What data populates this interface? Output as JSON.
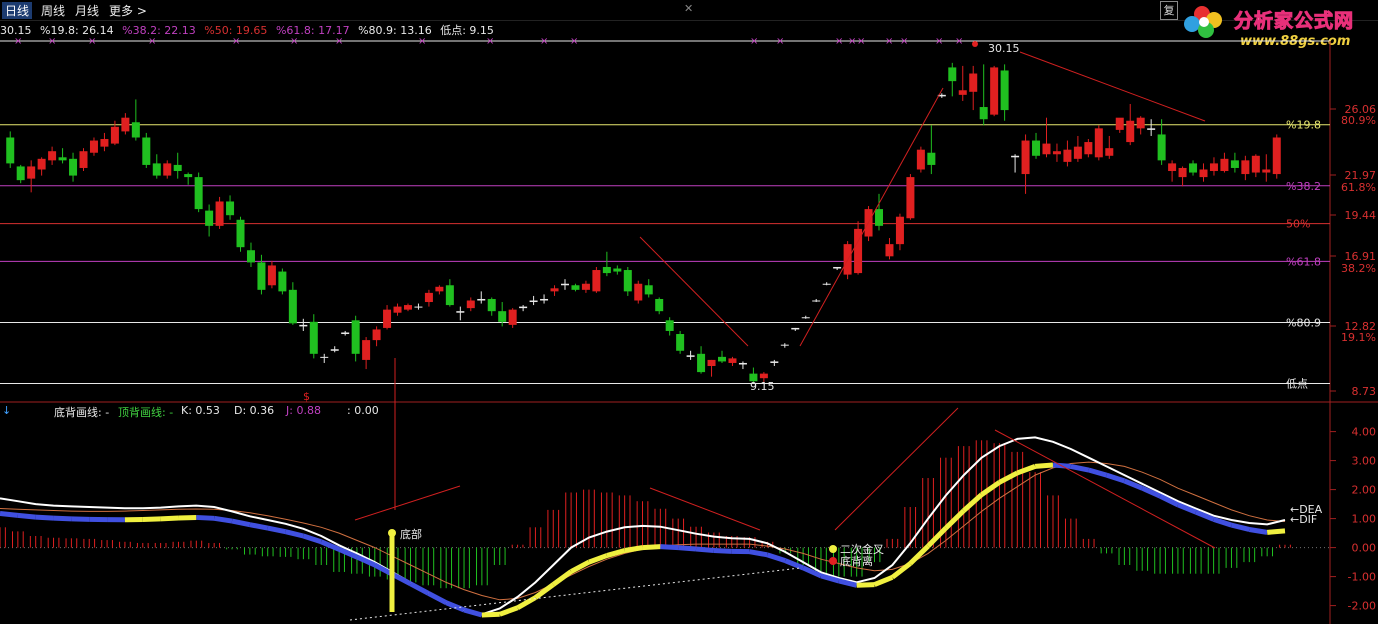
{
  "tabs": [
    "日线",
    "周线",
    "月线",
    "更多 >"
  ],
  "corner_button": "复",
  "logo": {
    "title": "分析家公式网",
    "url_text": "www.88gs.com"
  },
  "fib_header": [
    {
      "text": "30.15",
      "color": "#e8e8e8"
    },
    {
      "text": "%19.8: 26.14",
      "color": "#e8e8e8"
    },
    {
      "text": "%38.2: 22.13",
      "color": "#c040c0"
    },
    {
      "text": "%50: 19.65",
      "color": "#d83030"
    },
    {
      "text": "%61.8: 17.17",
      "color": "#c040c0"
    },
    {
      "text": "%80.9: 13.16",
      "color": "#e8e8e8"
    },
    {
      "text": "低点: 9.15",
      "color": "#e8e8e8"
    }
  ],
  "indicator_header": [
    {
      "text": "底背画线: -",
      "color": "#e8e8e8"
    },
    {
      "text": "顶背画线: -",
      "color": "#40d040"
    },
    {
      "text": "K: 0.53",
      "color": "#e8e8e8"
    },
    {
      "text": "D: 0.36",
      "color": "#e8e8e8"
    },
    {
      "text": "J: 0.88",
      "color": "#c040c0"
    },
    {
      "text": ": 0.00",
      "color": "#e8e8e8"
    }
  ],
  "chart_data": [
    {
      "type": "candlestick",
      "ylim": [
        8.2,
        31.7
      ],
      "y_axis_ticks": [
        {
          "price": "26.06",
          "pct": "80.9%"
        },
        {
          "price": "21.97",
          "pct": "61.8%"
        },
        {
          "price": "19.44",
          "pct": ""
        },
        {
          "price": "16.91",
          "pct": "38.2%"
        },
        {
          "price": "12.82",
          "pct": "19.1%"
        },
        {
          "price": "8.73",
          "pct": ""
        }
      ],
      "fib_levels": [
        {
          "label": "%19.8",
          "value": 26.14,
          "color": "#e8e870"
        },
        {
          "label": "%38.2",
          "value": 22.13,
          "color": "#c040c0"
        },
        {
          "label": "50%",
          "value": 19.65,
          "color": "#d83030"
        },
        {
          "label": "%61.8",
          "value": 17.17,
          "color": "#c040c0"
        },
        {
          "label": "%80.9",
          "value": 13.16,
          "color": "#e8e8e8"
        },
        {
          "label": "低点",
          "value": 9.15,
          "color": "#e8e8e8"
        }
      ],
      "annotations": [
        {
          "text": "30.15",
          "value": 30.15
        },
        {
          "text": "9.15",
          "value": 9.15
        }
      ],
      "candles": [
        [
          25.3,
          25.7,
          23.3,
          23.6
        ],
        [
          23.4,
          23.5,
          22.3,
          22.5
        ],
        [
          22.6,
          23.8,
          21.7,
          23.4
        ],
        [
          23.2,
          24.0,
          22.8,
          23.9
        ],
        [
          23.8,
          24.7,
          23.5,
          24.4
        ],
        [
          24.0,
          24.6,
          23.6,
          23.8
        ],
        [
          23.9,
          24.3,
          22.4,
          22.8
        ],
        [
          23.3,
          24.6,
          23.1,
          24.4
        ],
        [
          24.3,
          25.3,
          24.1,
          25.1
        ],
        [
          24.7,
          25.6,
          24.4,
          25.2
        ],
        [
          24.9,
          26.4,
          24.8,
          26.0
        ],
        [
          25.7,
          26.9,
          25.5,
          26.6
        ],
        [
          26.3,
          27.8,
          25.1,
          25.3
        ],
        [
          25.3,
          25.6,
          23.3,
          23.5
        ],
        [
          23.6,
          24.2,
          22.6,
          22.8
        ],
        [
          22.8,
          23.8,
          22.6,
          23.6
        ],
        [
          23.5,
          24.3,
          22.6,
          23.1
        ],
        [
          22.9,
          23.0,
          22.2,
          22.7
        ],
        [
          22.7,
          23.0,
          20.4,
          20.6
        ],
        [
          20.5,
          20.9,
          18.8,
          19.5
        ],
        [
          19.5,
          21.4,
          19.3,
          21.1
        ],
        [
          21.1,
          21.5,
          19.9,
          20.2
        ],
        [
          19.9,
          20.1,
          17.8,
          18.1
        ],
        [
          17.9,
          18.4,
          16.8,
          17.1
        ],
        [
          17.1,
          17.6,
          15.0,
          15.3
        ],
        [
          15.6,
          17.2,
          15.4,
          16.9
        ],
        [
          16.5,
          16.7,
          15.0,
          15.2
        ],
        [
          15.3,
          15.8,
          13.0,
          13.1
        ],
        [
          13.0,
          13.4,
          12.6,
          12.9
        ],
        [
          13.2,
          13.7,
          10.8,
          11.1
        ],
        [
          10.9,
          11.1,
          10.5,
          10.9
        ],
        [
          11.3,
          11.6,
          11.2,
          11.4
        ],
        [
          12.4,
          12.6,
          12.3,
          12.5
        ],
        [
          13.3,
          13.6,
          10.6,
          11.1
        ],
        [
          10.7,
          12.2,
          10.1,
          12.0
        ],
        [
          12.0,
          12.9,
          11.6,
          12.7
        ],
        [
          12.8,
          14.3,
          12.7,
          14.0
        ],
        [
          13.8,
          14.4,
          13.6,
          14.2
        ],
        [
          14.0,
          14.4,
          13.9,
          14.3
        ],
        [
          14.2,
          14.4,
          14.0,
          14.2
        ],
        [
          14.5,
          15.3,
          14.2,
          15.1
        ],
        [
          15.2,
          15.6,
          15.0,
          15.5
        ],
        [
          15.6,
          16.0,
          14.2,
          14.3
        ],
        [
          13.8,
          14.2,
          13.3,
          13.9
        ],
        [
          14.1,
          14.8,
          13.9,
          14.6
        ],
        [
          14.6,
          15.2,
          14.4,
          14.7
        ],
        [
          14.7,
          14.8,
          13.6,
          13.9
        ],
        [
          13.9,
          14.5,
          12.9,
          13.2
        ],
        [
          13.0,
          14.1,
          12.8,
          14.0
        ],
        [
          14.1,
          14.3,
          13.9,
          14.2
        ],
        [
          14.5,
          14.9,
          14.3,
          14.6
        ],
        [
          14.6,
          15.0,
          14.4,
          14.7
        ],
        [
          15.2,
          15.6,
          14.9,
          15.4
        ],
        [
          15.7,
          16.0,
          15.3,
          15.6
        ],
        [
          15.6,
          15.7,
          15.2,
          15.3
        ],
        [
          15.3,
          15.9,
          15.1,
          15.7
        ],
        [
          15.2,
          16.8,
          15.1,
          16.6
        ],
        [
          16.8,
          17.8,
          16.2,
          16.4
        ],
        [
          16.7,
          16.9,
          16.3,
          16.5
        ],
        [
          16.6,
          16.8,
          14.9,
          15.2
        ],
        [
          14.6,
          15.9,
          14.4,
          15.7
        ],
        [
          15.6,
          16.0,
          14.8,
          15.0
        ],
        [
          14.7,
          14.8,
          13.7,
          13.9
        ],
        [
          13.3,
          13.5,
          12.3,
          12.6
        ],
        [
          12.4,
          12.6,
          11.1,
          11.3
        ],
        [
          11.0,
          11.3,
          10.7,
          10.9
        ],
        [
          11.1,
          11.6,
          9.8,
          9.9
        ],
        [
          10.3,
          10.7,
          9.6,
          10.7
        ],
        [
          10.9,
          11.3,
          10.5,
          10.6
        ],
        [
          10.5,
          10.9,
          10.3,
          10.8
        ],
        [
          10.5,
          10.6,
          10.1,
          10.4
        ],
        [
          9.8,
          10.2,
          9.2,
          9.3
        ],
        [
          9.5,
          9.9,
          9.2,
          9.8
        ],
        [
          10.5,
          10.7,
          10.3,
          10.6
        ],
        [
          11.7,
          11.8,
          11.5,
          11.7
        ],
        [
          12.7,
          12.8,
          12.6,
          12.8
        ],
        [
          13.5,
          13.6,
          13.4,
          13.5
        ],
        [
          14.6,
          14.7,
          14.5,
          14.6
        ],
        [
          15.7,
          15.8,
          15.6,
          15.7
        ],
        [
          16.7,
          16.8,
          16.6,
          16.8
        ],
        [
          16.3,
          18.5,
          16.0,
          18.3
        ],
        [
          16.4,
          19.8,
          16.3,
          19.3
        ],
        [
          18.8,
          20.8,
          18.5,
          20.6
        ],
        [
          20.6,
          21.6,
          19.2,
          19.5
        ],
        [
          17.5,
          18.7,
          17.3,
          18.3
        ],
        [
          18.3,
          20.3,
          17.9,
          20.1
        ],
        [
          20.0,
          22.9,
          19.9,
          22.7
        ],
        [
          23.2,
          24.7,
          23.0,
          24.5
        ],
        [
          24.3,
          26.1,
          22.9,
          23.5
        ],
        [
          28.1,
          28.2,
          27.9,
          28.0
        ],
        [
          29.9,
          30.2,
          28.0,
          29.0
        ],
        [
          28.1,
          30.0,
          27.7,
          28.4
        ],
        [
          28.3,
          30.0,
          27.1,
          29.5
        ],
        [
          27.3,
          30.1,
          26.1,
          26.5
        ],
        [
          26.8,
          30.0,
          26.7,
          29.9
        ],
        [
          29.7,
          30.1,
          26.4,
          27.1
        ],
        [
          24.0,
          24.2,
          23.0,
          24.1
        ],
        [
          22.9,
          25.5,
          21.6,
          25.1
        ],
        [
          25.1,
          25.6,
          23.9,
          24.1
        ],
        [
          24.2,
          26.6,
          24.0,
          24.9
        ],
        [
          24.2,
          24.9,
          23.7,
          24.4
        ],
        [
          23.7,
          25.1,
          23.4,
          24.5
        ],
        [
          23.9,
          25.4,
          23.7,
          24.7
        ],
        [
          24.2,
          25.2,
          24.0,
          25.0
        ],
        [
          24.0,
          26.1,
          23.8,
          25.9
        ],
        [
          24.1,
          25.4,
          23.9,
          24.6
        ],
        [
          25.8,
          26.3,
          25.6,
          26.6
        ],
        [
          25.0,
          27.5,
          24.8,
          26.4
        ],
        [
          25.9,
          26.7,
          25.5,
          26.6
        ],
        [
          25.9,
          26.5,
          25.4,
          25.8
        ],
        [
          25.5,
          26.5,
          23.5,
          23.8
        ],
        [
          23.1,
          23.8,
          22.4,
          23.6
        ],
        [
          22.7,
          23.4,
          22.1,
          23.3
        ],
        [
          23.6,
          23.8,
          22.8,
          23.0
        ],
        [
          22.7,
          23.6,
          22.4,
          23.2
        ],
        [
          23.1,
          24.0,
          22.8,
          23.6
        ],
        [
          23.1,
          24.3,
          23.0,
          23.9
        ],
        [
          23.8,
          24.3,
          23.0,
          23.3
        ],
        [
          22.9,
          24.1,
          22.5,
          23.8
        ],
        [
          23.0,
          24.2,
          22.7,
          24.1
        ],
        [
          23.0,
          24.2,
          22.4,
          23.2
        ],
        [
          22.9,
          25.5,
          22.6,
          25.3
        ]
      ]
    },
    {
      "type": "macd",
      "ylim": [
        -2.6,
        4.4
      ],
      "y_axis_ticks": [
        "4.00",
        "3.00",
        "2.00",
        "1.00",
        "0.00",
        "-1.00",
        "-2.00"
      ],
      "dif": [
        1.7,
        1.6,
        1.5,
        1.45,
        1.42,
        1.4,
        1.38,
        1.36,
        1.36,
        1.38,
        1.42,
        1.45,
        1.4,
        1.25,
        1.08,
        0.95,
        0.82,
        0.65,
        0.4,
        0.08,
        -0.2,
        -0.5,
        -0.85,
        -1.2,
        -1.55,
        -1.9,
        -2.15,
        -2.3,
        -2.1,
        -1.7,
        -1.2,
        -0.6,
        0.0,
        0.35,
        0.55,
        0.7,
        0.75,
        0.72,
        0.6,
        0.48,
        0.38,
        0.32,
        0.3,
        0.15,
        -0.15,
        -0.5,
        -0.85,
        -1.05,
        -1.2,
        -1.05,
        -0.6,
        0.15,
        1.0,
        1.8,
        2.5,
        3.1,
        3.5,
        3.75,
        3.8,
        3.65,
        3.4,
        3.1,
        2.8,
        2.5,
        2.2,
        1.9,
        1.6,
        1.35,
        1.1,
        0.95,
        0.85,
        0.8,
        0.95
      ],
      "dea": [
        1.35,
        1.32,
        1.3,
        1.28,
        1.26,
        1.25,
        1.25,
        1.26,
        1.28,
        1.3,
        1.32,
        1.33,
        1.32,
        1.28,
        1.2,
        1.1,
        0.98,
        0.85,
        0.7,
        0.5,
        0.25,
        0.0,
        -0.3,
        -0.6,
        -0.9,
        -1.2,
        -1.45,
        -1.65,
        -1.8,
        -1.75,
        -1.55,
        -1.25,
        -0.95,
        -0.65,
        -0.4,
        -0.2,
        -0.05,
        0.05,
        0.1,
        0.12,
        0.12,
        0.12,
        0.12,
        0.05,
        -0.05,
        -0.2,
        -0.4,
        -0.55,
        -0.7,
        -0.8,
        -0.75,
        -0.55,
        -0.2,
        0.25,
        0.75,
        1.25,
        1.7,
        2.1,
        2.5,
        2.75,
        2.9,
        2.95,
        2.9,
        2.8,
        2.6,
        2.35,
        2.05,
        1.8,
        1.55,
        1.3,
        1.1,
        0.95,
        0.9
      ],
      "labels": [
        {
          "text": "底部",
          "color": "#e8e8e8"
        },
        {
          "text": "二次金叉",
          "color": "#e8e8e8"
        },
        {
          "text": "底背离",
          "color": "#e8e8e8"
        },
        {
          "text": "←DEA",
          "color": "#e8e8e8"
        },
        {
          "text": "←DIF",
          "color": "#e8e8e8"
        }
      ],
      "markers": [
        "$"
      ]
    }
  ]
}
